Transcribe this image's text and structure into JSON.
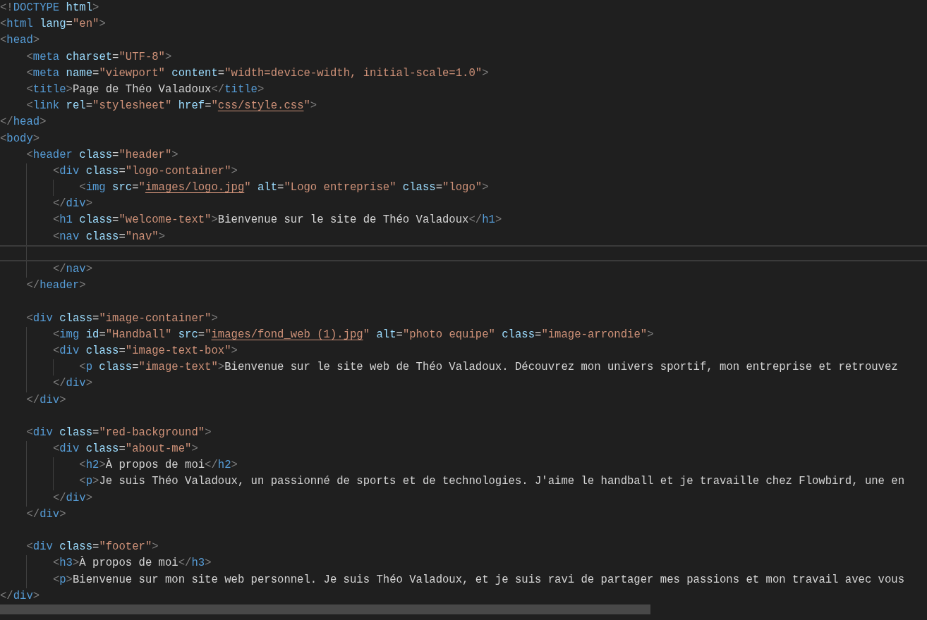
{
  "editor": {
    "lines": [
      {
        "current": false,
        "text": "<!DOCTYPE html>"
      },
      {
        "current": false,
        "text": "<html lang=\"en\">"
      },
      {
        "current": false,
        "text": "<head>"
      },
      {
        "current": false,
        "text": "    <meta charset=\"UTF-8\">"
      },
      {
        "current": false,
        "text": "    <meta name=\"viewport\" content=\"width=device-width, initial-scale=1.0\">"
      },
      {
        "current": false,
        "text": "    <title>Page de Théo Valadoux</title>"
      },
      {
        "current": false,
        "text": "    <link rel=\"stylesheet\" href=\"css/style.css\">"
      },
      {
        "current": false,
        "text": "</head>"
      },
      {
        "current": false,
        "text": "<body>"
      },
      {
        "current": false,
        "text": "    <header class=\"header\">"
      },
      {
        "current": false,
        "text": "        <div class=\"logo-container\">"
      },
      {
        "current": false,
        "text": "            <img src=\"images/logo.jpg\" alt=\"Logo entreprise\" class=\"logo\">"
      },
      {
        "current": false,
        "text": "        </div>"
      },
      {
        "current": false,
        "text": "        <h1 class=\"welcome-text\">Bienvenue sur le site de Théo Valadoux</h1>"
      },
      {
        "current": false,
        "text": "        <nav class=\"nav\">"
      },
      {
        "current": true
      },
      {
        "current": false,
        "text": "        </nav>"
      },
      {
        "current": false,
        "text": "    </header>"
      },
      {
        "current": false
      },
      {
        "current": false,
        "text": "    <div class=\"image-container\">"
      },
      {
        "current": false,
        "text": "        <img id=\"Handball\" src=\"images/fond_web (1).jpg\" alt=\"photo equipe\" class=\"image-arrondie\">"
      },
      {
        "current": false,
        "text": "        <div class=\"image-text-box\">"
      },
      {
        "current": false,
        "text": "            <p class=\"image-text\">Bienvenue sur le site web de Théo Valadoux. Découvrez mon univers sportif, mon entreprise et retrouvez"
      },
      {
        "current": false,
        "text": "        </div>"
      },
      {
        "current": false,
        "text": "    </div>"
      },
      {
        "current": false
      },
      {
        "current": false,
        "text": "    <div class=\"red-background\">"
      },
      {
        "current": false,
        "text": "        <div class=\"about-me\">"
      },
      {
        "current": false,
        "text": "            <h2>À propos de moi</h2>"
      },
      {
        "current": false,
        "text": "            <p>Je suis Théo Valadoux, un passionné de sports et de technologies. J'aime le handball et je travaille chez Flowbird, une en"
      },
      {
        "current": false,
        "text": "        </div>"
      },
      {
        "current": false,
        "text": "    </div>"
      },
      {
        "current": false
      },
      {
        "current": false,
        "text": "    <div class=\"footer\">"
      },
      {
        "current": false,
        "text": "        <h3>À propos de moi</h3>"
      },
      {
        "current": false,
        "text": "        <p>Bienvenue sur mon site web personnel. Je suis Théo Valadoux, et je suis ravi de partager mes passions et mon travail avec vous"
      },
      {
        "current": false,
        "text": "</div>"
      }
    ]
  }
}
